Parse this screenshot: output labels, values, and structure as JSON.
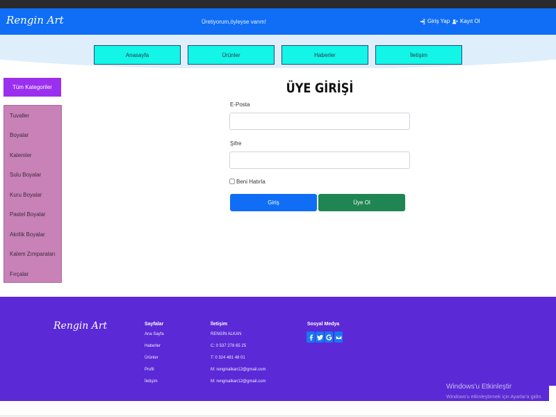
{
  "navbar": {
    "brand": "Rengin Art",
    "slogan": "Üretiyorum,öyleyse varım!",
    "login_link": "Giriş Yap",
    "register_link": "Kayıt Ol"
  },
  "menu": [
    "Anasayfa",
    "Ürünler",
    "Haberler",
    "İletişim"
  ],
  "categories": {
    "header": "Tüm Kategoriler",
    "items": [
      "Tuvaller",
      "Boyalar",
      "Kalemler",
      "Sulu Boyalar",
      "Kuru Boyalar",
      "Pastel Boyalar",
      "Akrilik Boyalar",
      "Kalem Zımparaları",
      "Fırçalar"
    ]
  },
  "login": {
    "title": "ÜYE GİRİŞİ",
    "email_label": "E-Posta",
    "email_value": "",
    "password_label": "Şifre",
    "password_value": "",
    "remember_label": "Beni Hatırla",
    "remember_checked": false,
    "submit_label": "Giriş",
    "register_label": "Üye Ol"
  },
  "footer": {
    "brand": "Rengin Art",
    "pages": {
      "title": "Sayfalar",
      "items": [
        "Ana Sayfa",
        "Haberler",
        "Ürünler",
        "Profil",
        "İletişim"
      ]
    },
    "contact": {
      "title": "İletişim",
      "items": [
        "RENGİN ALKAN",
        "C: 0 537 278 65 25",
        "T: 0 324 481 48 01",
        "M: renginalkan12@gmail.com",
        "M: renginalkan12@gmail.com"
      ]
    },
    "social": {
      "title": "Sosyal Medya",
      "icons": [
        "facebook-icon",
        "twitter-icon",
        "google-icon",
        "mail-icon"
      ],
      "color": "#1877f2"
    }
  },
  "windows_watermark": {
    "title": "Windows'u Etkinleştir",
    "subtitle": "Windows'u etkinleştirmek için Ayarlar'a gidin."
  },
  "colors": {
    "navbar": "#0f6ef5",
    "menu_button": "#13f5e6",
    "category_header": "#9b2ff0",
    "category_list": "#c882b8",
    "login_button": "#0f6ef5",
    "register_button": "#1f8552",
    "footer": "#5b29d6"
  }
}
